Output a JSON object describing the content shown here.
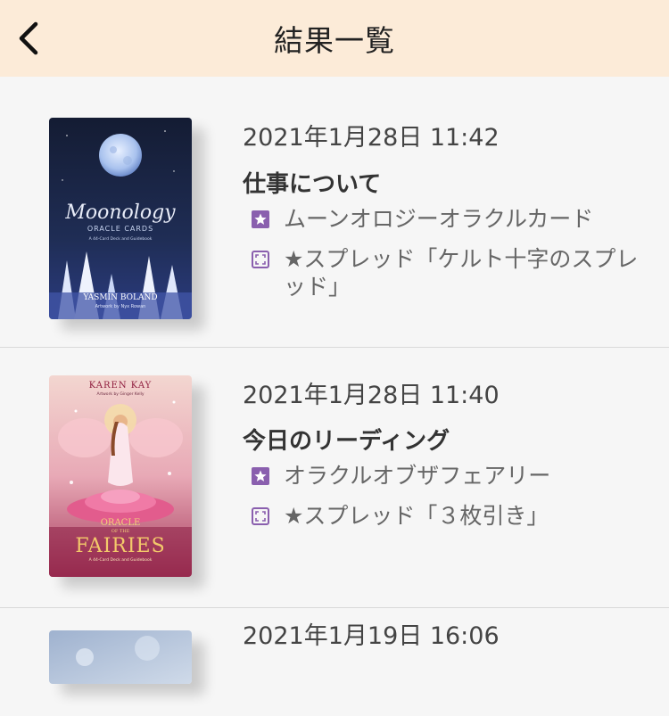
{
  "header": {
    "title": "結果一覧",
    "back_icon": "chevron-left-icon",
    "background": "#fcebd8"
  },
  "accent_color": "#8a5fae",
  "results": [
    {
      "date": "2021年1月28日 11:42",
      "title": "仕事について",
      "deck": "ムーンオロジーオラクルカード",
      "spread": "★スプレッド「ケルト十字のスプレッド」",
      "cover": {
        "title": "Moonology",
        "subtitle": "ORACLE CARDS",
        "tagline": "A 44-Card Deck and Guidebook",
        "author": "YASMIN BOLAND",
        "artist": "Artwork by Nyx Rowan"
      }
    },
    {
      "date": "2021年1月28日 11:40",
      "title": "今日のリーディング",
      "deck": "オラクルオブザフェアリー",
      "spread": "★スプレッド「３枚引き」",
      "cover": {
        "author": "KAREN KAY",
        "artist": "Artwork by Ginger Kelly",
        "title_line1": "ORACLE",
        "title_line2": "OF THE",
        "title_line3": "FAIRIES",
        "tagline": "A 44-Card Deck and Guidebook"
      }
    },
    {
      "date": "2021年1月19日 16:06"
    }
  ]
}
